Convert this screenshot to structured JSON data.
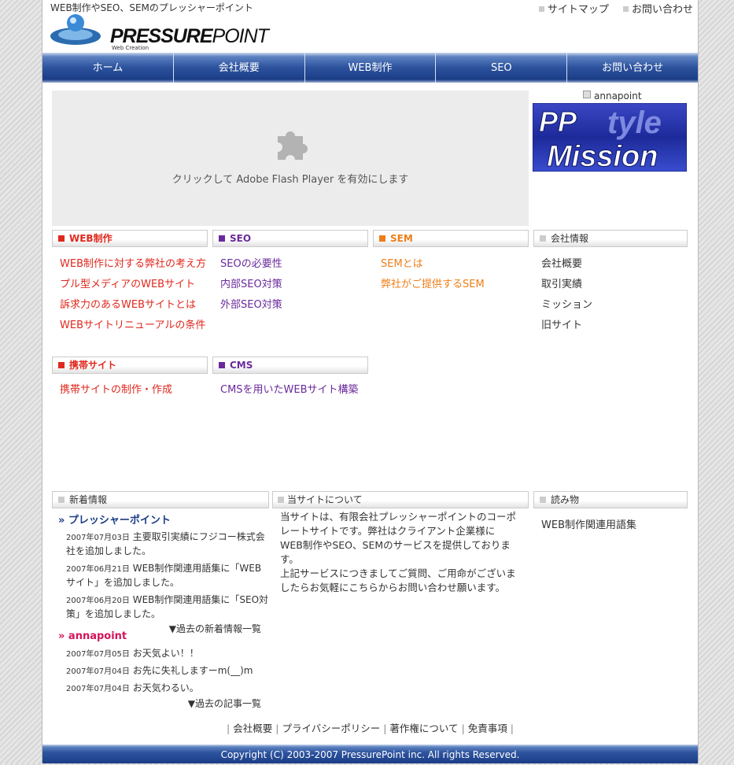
{
  "header": {
    "tagline": "WEB制作やSEO、SEMのプレッシャーポイント",
    "logo": {
      "brand_bold": "PRESSURE",
      "brand_thin": "POINT",
      "sub": "Web Creation"
    },
    "top_links": [
      "サイトマップ",
      "お問い合わせ"
    ]
  },
  "nav": [
    "ホーム",
    "会社概要",
    "WEB制作",
    "SEO",
    "お問い合わせ"
  ],
  "flash": {
    "message": "クリックして Adobe Flash Player を有効にします"
  },
  "banner": {
    "alt": "annapoint",
    "line1": "PP",
    "line1_overlay": "tyle",
    "line2": "Mission"
  },
  "sections": [
    {
      "title": "WEB制作",
      "color": "#e0281e",
      "links": [
        "WEB制作に対する弊社の考え方",
        "プル型メディアのWEBサイト",
        "訴求力のあるWEBサイトとは",
        "WEBサイトリニューアルの条件"
      ]
    },
    {
      "title": "SEO",
      "color": "#6a2a9c",
      "links": [
        "SEOの必要性",
        "内部SEO対策",
        "外部SEO対策"
      ]
    },
    {
      "title": "SEM",
      "color": "#ee7e18",
      "links": [
        "SEMとは",
        "弊社がご提供するSEM"
      ]
    },
    {
      "title": "会社情報",
      "color": "#cccccc",
      "links": [
        "会社概要",
        "取引実績",
        "ミッション",
        "旧サイト"
      ]
    },
    {
      "title": "携帯サイト",
      "color": "#e0281e",
      "links": [
        "携帯サイトの制作・作成"
      ]
    },
    {
      "title": "CMS",
      "color": "#6a2a9c",
      "links": [
        "CMSを用いたWEBサイト構築"
      ]
    }
  ],
  "bottom_heads": [
    "新着情報",
    "当サイトについて",
    "読み物"
  ],
  "news": {
    "title": "» プレッシャーポイント",
    "items": [
      {
        "date": "2007年07月03日",
        "text": "主要取引実績にフジコー株式会社を追加しました。"
      },
      {
        "date": "2007年06月21日",
        "text": "WEB制作関連用語集に「WEBサイト」を追加しました。"
      },
      {
        "date": "2007年06月20日",
        "text": "WEB制作関連用語集に「SEO対策」を追加しました。"
      }
    ],
    "more": "▼過去の新着情報一覧"
  },
  "blog": {
    "title": "» annapoint",
    "items": [
      {
        "date": "2007年07月05日",
        "text": "お天気よい！！"
      },
      {
        "date": "2007年07月04日",
        "text": "お先に失礼しますーm(__)m"
      },
      {
        "date": "2007年07月04日",
        "text": "お天気わるい。"
      }
    ],
    "more": "▼過去の記事一覧"
  },
  "about": {
    "p1": "当サイトは、有限会社プレッシャーポイントのコーポレートサイトです。弊社はクライアント企業様にWEB制作やSEO、SEMのサービスを提供しております。",
    "p2": "上記サービスにつきましてご質問、ご用命がございましたらお気軽にこちらからお問い合わせ願います。"
  },
  "reading": [
    "WEB制作関連用語集"
  ],
  "footer": {
    "links": [
      "会社概要",
      "プライバシーポリシー",
      "著作権について",
      "免責事項"
    ],
    "copyright": "Copyright (C) 2003-2007 PressurePoint inc. All rights Reserved."
  }
}
